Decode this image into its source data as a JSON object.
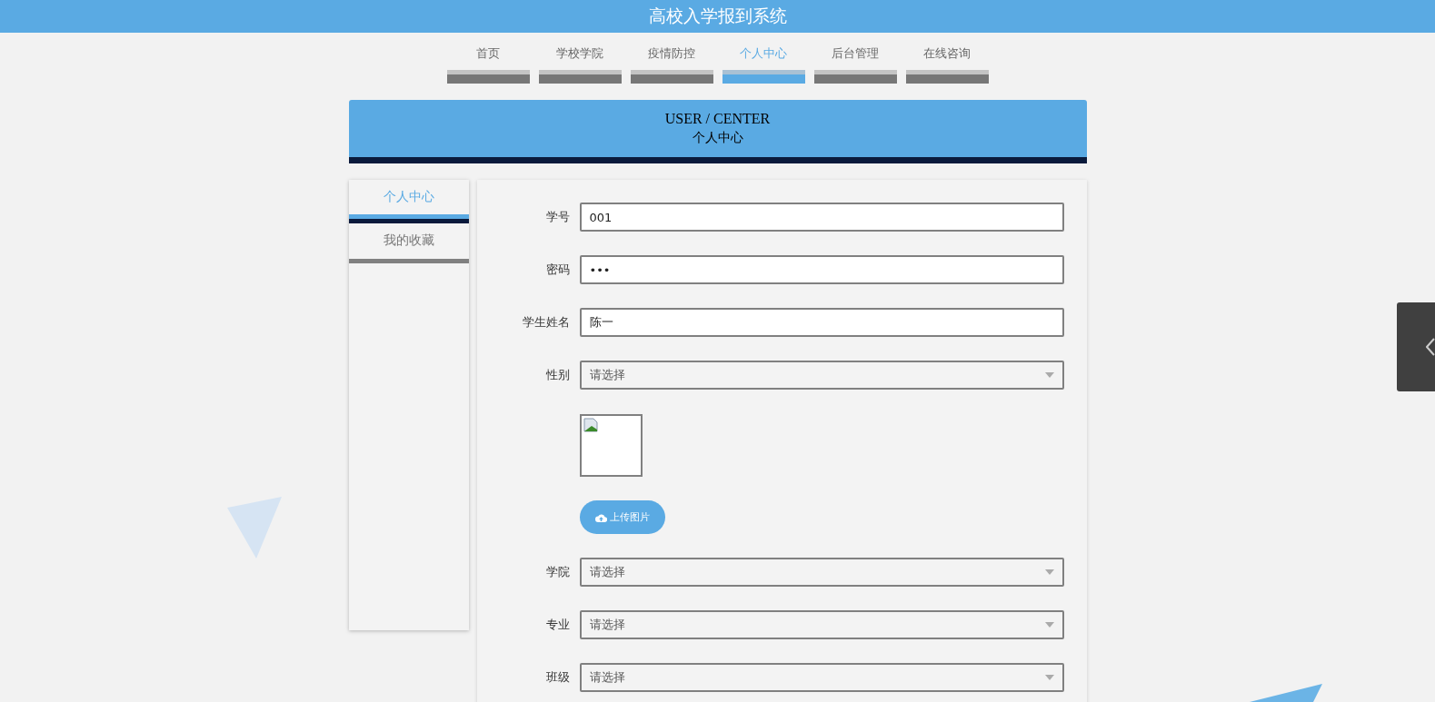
{
  "header": {
    "title": "高校入学报到系统"
  },
  "nav": [
    {
      "label": "首页",
      "selected": false
    },
    {
      "label": "学校学院",
      "selected": false
    },
    {
      "label": "疫情防控",
      "selected": false
    },
    {
      "label": "个人中心",
      "selected": true
    },
    {
      "label": "后台管理",
      "selected": false
    },
    {
      "label": "在线咨询",
      "selected": false
    }
  ],
  "banner": {
    "title": "USER / CENTER",
    "subtitle": "个人中心"
  },
  "sidebar": [
    {
      "label": "个人中心",
      "selected": true
    },
    {
      "label": "我的收藏",
      "selected": false
    }
  ],
  "form": [
    {
      "kind": "text",
      "label": "学号",
      "value": "001"
    },
    {
      "kind": "password",
      "label": "密码",
      "value": "•••"
    },
    {
      "kind": "text",
      "label": "学生姓名",
      "value": "陈一"
    },
    {
      "kind": "select",
      "label": "性别",
      "placeholder": "请选择"
    },
    {
      "kind": "image"
    },
    {
      "kind": "upload",
      "label": "上传图片"
    },
    {
      "kind": "select",
      "label": "学院",
      "placeholder": "请选择"
    },
    {
      "kind": "select",
      "label": "专业",
      "placeholder": "请选择"
    },
    {
      "kind": "select",
      "label": "班级",
      "placeholder": "请选择"
    }
  ]
}
